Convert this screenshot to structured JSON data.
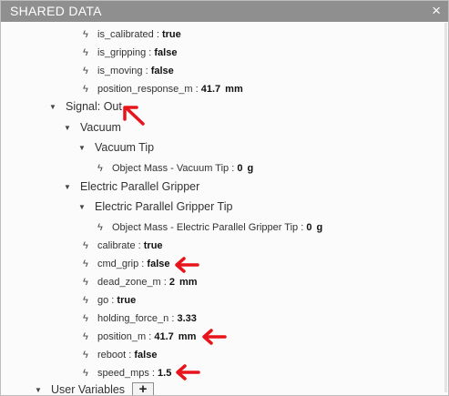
{
  "window": {
    "title": "SHARED DATA",
    "close_glyph": "×"
  },
  "rows_top": [
    {
      "name": "is_calibrated",
      "sep": " : ",
      "value": "true",
      "unit": ""
    },
    {
      "name": "is_gripping",
      "sep": " : ",
      "value": "false",
      "unit": ""
    },
    {
      "name": "is_moving",
      "sep": " : ",
      "value": "false",
      "unit": ""
    },
    {
      "name": "position_response_m",
      "sep": " : ",
      "value": "41.7",
      "unit": "mm"
    }
  ],
  "signal_out": {
    "label": "Signal: Out"
  },
  "vacuum": {
    "label": "Vacuum",
    "tip_label": "Vacuum Tip",
    "mass_row": {
      "name": "Object Mass - Vacuum Tip",
      "sep": " : ",
      "value": "0",
      "unit": "g"
    }
  },
  "gripper": {
    "label": "Electric Parallel Gripper",
    "tip_label": "Electric Parallel Gripper Tip",
    "mass_row": {
      "name": "Object Mass - Electric Parallel Gripper Tip",
      "sep": " : ",
      "value": "0",
      "unit": "g"
    },
    "rows": [
      {
        "name": "calibrate",
        "sep": " : ",
        "value": "true",
        "unit": ""
      },
      {
        "name": "cmd_grip",
        "sep": " : ",
        "value": "false",
        "unit": ""
      },
      {
        "name": "dead_zone_m",
        "sep": " : ",
        "value": "2",
        "unit": "mm"
      },
      {
        "name": "go",
        "sep": " : ",
        "value": "true",
        "unit": ""
      },
      {
        "name": "holding_force_n",
        "sep": " : ",
        "value": "3.33",
        "unit": ""
      },
      {
        "name": "position_m",
        "sep": " : ",
        "value": "41.7",
        "unit": "mm"
      },
      {
        "name": "reboot",
        "sep": " : ",
        "value": "false",
        "unit": ""
      },
      {
        "name": "speed_mps",
        "sep": " : ",
        "value": "1.5",
        "unit": ""
      }
    ]
  },
  "user_variables": {
    "label": "User Variables",
    "add_glyph": "+"
  },
  "icons": {
    "bolt": "lightning-bolt-icon",
    "expanded": "triangle-down-icon",
    "annotation": "red-arrow-annotation"
  },
  "colors": {
    "titlebar": "#8f8f8f",
    "annotation": "#e8141b"
  }
}
